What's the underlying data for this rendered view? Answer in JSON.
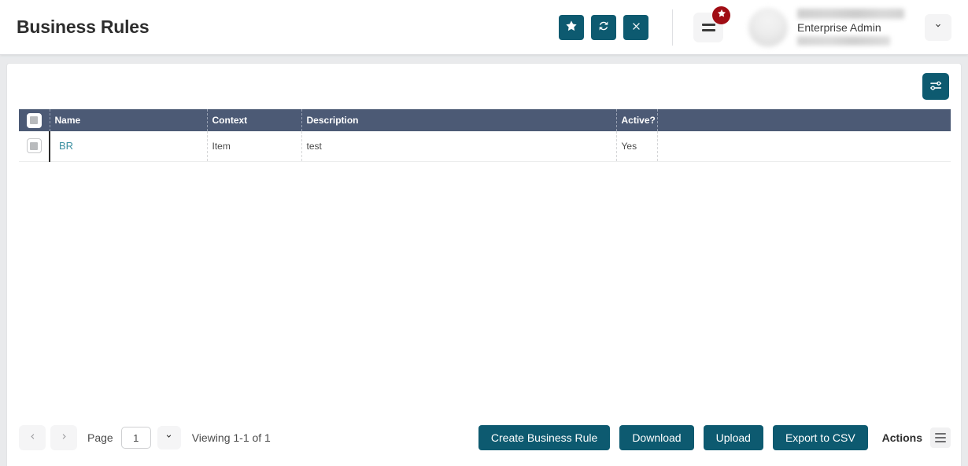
{
  "header": {
    "title": "Business Rules",
    "icon_buttons": [
      {
        "name": "favorite-button",
        "icon": "star-icon"
      },
      {
        "name": "refresh-button",
        "icon": "refresh-icon"
      },
      {
        "name": "close-button",
        "icon": "close-icon"
      }
    ],
    "menu": {
      "name": "main-menu-button",
      "icon": "hamburger-icon",
      "badge_icon": "star-icon"
    },
    "user": {
      "role": "Enterprise Admin"
    },
    "user_dropdown_icon": "chevron-down-icon",
    "accent_color": "#0d5a70",
    "badge_color": "#a00d14"
  },
  "toolbar": {
    "filter_button": {
      "name": "filter-settings-button",
      "icon": "sliders-icon"
    }
  },
  "table": {
    "header_checkbox": "select-all-checkbox",
    "columns": [
      {
        "key": "name",
        "label": "Name"
      },
      {
        "key": "context",
        "label": "Context"
      },
      {
        "key": "description",
        "label": "Description"
      },
      {
        "key": "active",
        "label": "Active?"
      }
    ],
    "rows": [
      {
        "name": "BR",
        "context": "Item",
        "description": "test",
        "active": "Yes"
      }
    ],
    "header_bg": "#4c5a75",
    "link_color": "#3a8fa0"
  },
  "pagination": {
    "prev_icon": "chevron-left-icon",
    "next_icon": "chevron-right-icon",
    "page_label": "Page",
    "page_value": "1",
    "page_placeholder": "1",
    "dropdown_icon": "chevron-down-icon",
    "viewing_text": "Viewing 1-1 of 1"
  },
  "footer_actions": {
    "buttons": [
      {
        "name": "create-business-rule-button",
        "label": "Create Business Rule"
      },
      {
        "name": "download-button",
        "label": "Download"
      },
      {
        "name": "upload-button",
        "label": "Upload"
      },
      {
        "name": "export-to-csv-button",
        "label": "Export to CSV"
      }
    ],
    "actions_label": "Actions",
    "actions_icon": "hamburger-icon"
  }
}
